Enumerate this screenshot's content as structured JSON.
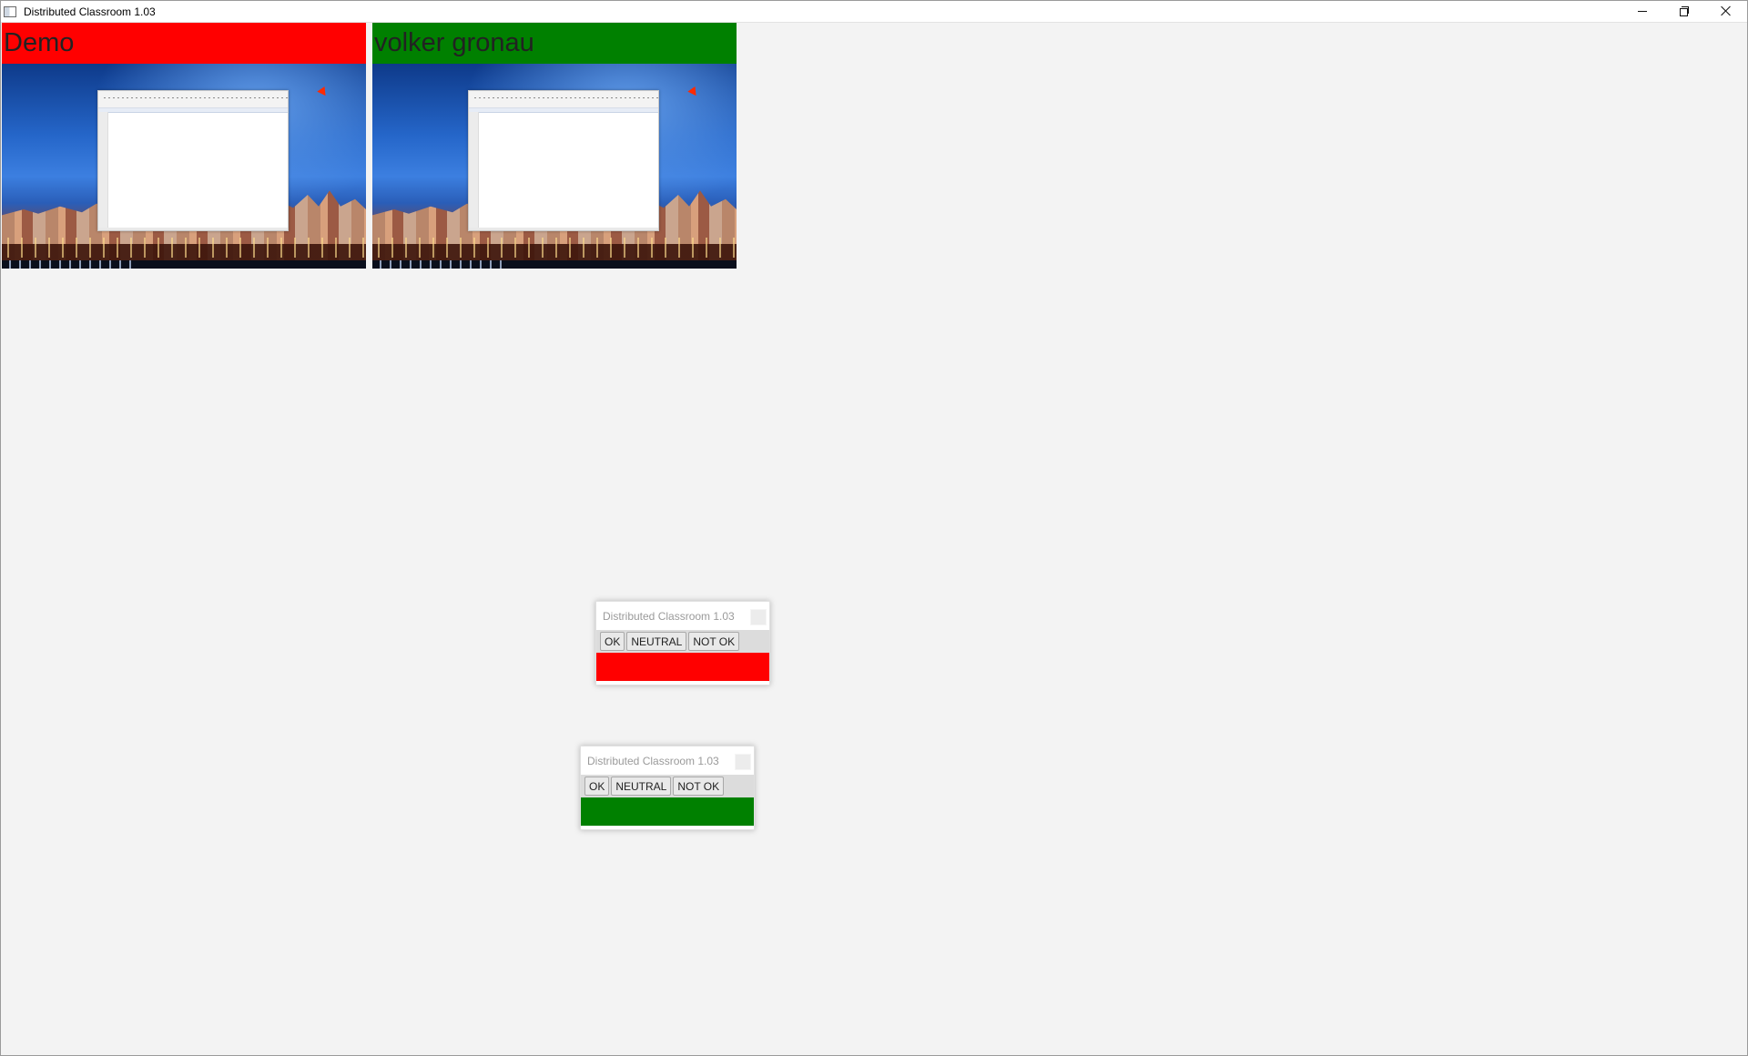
{
  "window": {
    "title": "Distributed Classroom 1.03"
  },
  "tiles": [
    {
      "name": "Demo",
      "color": "#ff0000"
    },
    {
      "name": "volker gronau",
      "color": "#008000"
    }
  ],
  "popups": [
    {
      "title": "Distributed Classroom 1.03",
      "buttons": {
        "ok": "OK",
        "neutral": "NEUTRAL",
        "not_ok": "NOT OK"
      },
      "status_color": "#ff0000"
    },
    {
      "title": "Distributed Classroom 1.03",
      "buttons": {
        "ok": "OK",
        "neutral": "NEUTRAL",
        "not_ok": "NOT OK"
      },
      "status_color": "#008000"
    }
  ],
  "icons": {
    "app": "app-icon",
    "minimize": "minimize-icon",
    "restore": "restore-icon",
    "close": "close-icon"
  }
}
